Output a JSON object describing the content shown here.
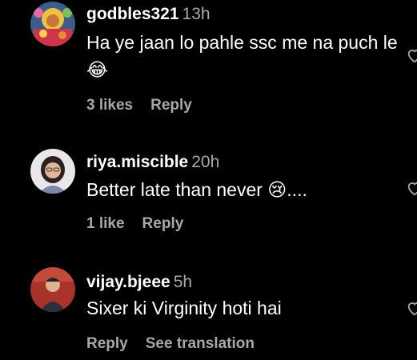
{
  "comments": [
    {
      "username": "godbles321",
      "time": "13h",
      "text": "Ha ye jaan lo pahle ssc me na puch le 😂",
      "likes": "3 likes",
      "reply": "Reply"
    },
    {
      "username": "riya.miscible",
      "time": "20h",
      "text": "Better late than never 😢....",
      "likes": "1 like",
      "reply": "Reply"
    },
    {
      "username": "vijay.bjeee",
      "time": "5h",
      "text": "Sixer ki Virginity hoti hai",
      "reply": "Reply",
      "translate": "See translation"
    }
  ],
  "icons": {
    "like": "heart-outline-icon"
  },
  "colors": {
    "background": "#000000",
    "primary_text": "#ffffff",
    "secondary_text": "#a8a8a8"
  }
}
